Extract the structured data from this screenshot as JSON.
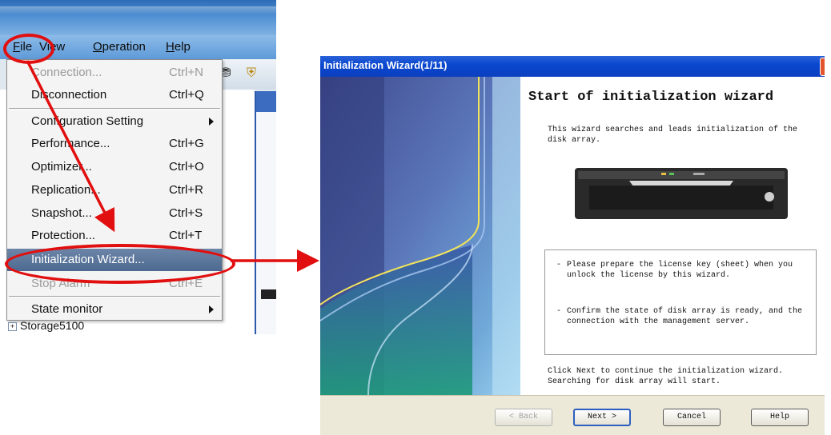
{
  "menubar": {
    "items": [
      {
        "label": "File",
        "underline": "F"
      },
      {
        "label": "View"
      },
      {
        "label": "Operation",
        "underline": "O"
      },
      {
        "label": "Help",
        "underline": "H"
      }
    ]
  },
  "file_menu": {
    "items": [
      {
        "label": "Connection...",
        "shortcut": "Ctrl+N",
        "disabled": true
      },
      {
        "label": "Disconnection",
        "shortcut": "Ctrl+Q"
      },
      {
        "label": "Configuration Setting",
        "submenu": true
      },
      {
        "label": "Performance...",
        "shortcut": "Ctrl+G"
      },
      {
        "label": "Optimizer...",
        "shortcut": "Ctrl+O"
      },
      {
        "label": "Replication...",
        "shortcut": "Ctrl+R"
      },
      {
        "label": "Snapshot...",
        "shortcut": "Ctrl+S"
      },
      {
        "label": "Protection...",
        "shortcut": "Ctrl+T"
      },
      {
        "label": "Initialization Wizard...",
        "highlighted": true
      },
      {
        "label": "Stop Alarm",
        "shortcut": "Ctrl+E",
        "disabled": true
      },
      {
        "label": "State monitor",
        "submenu": true
      }
    ]
  },
  "tree": {
    "item_label": "Storage5100"
  },
  "wizard": {
    "title": "Initialization Wizard(1/11)",
    "heading": "Start of initialization wizard",
    "intro": "This wizard searches and leads initialization of the disk array.",
    "notes": [
      "Please prepare the license key (sheet) when you unlock the license by this wizard.",
      "Confirm the state of disk array is ready, and the connection with the management server."
    ],
    "tail_line1": "Click Next to continue the initialization wizard.",
    "tail_line2": "Searching for disk array will start.",
    "buttons": {
      "back": "< Back",
      "next": "Next >",
      "cancel": "Cancel",
      "help": "Help"
    }
  },
  "colors": {
    "callout": "#e10f0f",
    "title_bar": "#0b47cf",
    "highlight": "#546f95"
  },
  "icons": [
    "disk-icon",
    "shield-icon",
    "close-icon",
    "submenu-arrow-icon",
    "tree-expand-icon",
    "disk-array-device-image"
  ]
}
